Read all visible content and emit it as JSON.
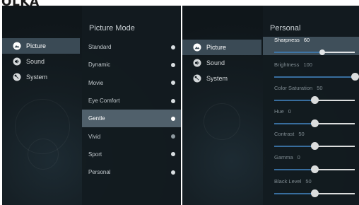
{
  "brand": "OLKA",
  "nav": {
    "items": [
      {
        "label": "Picture",
        "icon": "picture-icon"
      },
      {
        "label": "Sound",
        "icon": "sound-icon"
      },
      {
        "label": "System",
        "icon": "system-icon"
      }
    ],
    "active_index": 0
  },
  "picture_mode_panel": {
    "title": "Picture Mode",
    "modes": [
      {
        "label": "Standard",
        "checked": false
      },
      {
        "label": "Dynamic",
        "checked": false
      },
      {
        "label": "Movie",
        "checked": false
      },
      {
        "label": "Eye Comfort",
        "checked": false
      },
      {
        "label": "Gentle",
        "checked": false
      },
      {
        "label": "Vivid",
        "checked": true
      },
      {
        "label": "Sport",
        "checked": false
      },
      {
        "label": "Personal",
        "checked": false
      }
    ],
    "highlighted_index": 4
  },
  "personal_panel": {
    "title": "Personal",
    "settings": [
      {
        "label": "Sharpness",
        "value": "60",
        "level": 60
      },
      {
        "label": "Brightness",
        "value": "100",
        "level": 100
      },
      {
        "label": "Color Saturation",
        "value": "50",
        "level": 50
      },
      {
        "label": "Hue",
        "value": "0",
        "level": 50
      },
      {
        "label": "Contrast",
        "value": "50",
        "level": 50
      },
      {
        "label": "Gamma",
        "value": "0",
        "level": 50
      },
      {
        "label": "Black Level",
        "value": "50",
        "level": 50
      }
    ],
    "focused_index": 0
  },
  "colors": {
    "slider_fill": "#3f7cb3",
    "highlight": "#50606b",
    "background": "#141d22"
  }
}
